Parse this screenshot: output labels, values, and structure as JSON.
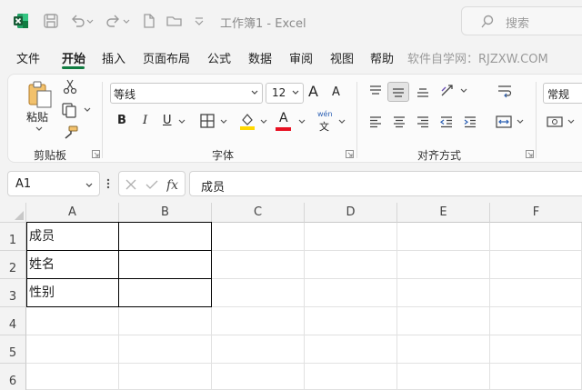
{
  "title": "工作簿1 - Excel",
  "search": {
    "placeholder": "搜索"
  },
  "menu": [
    "文件",
    "开始",
    "插入",
    "页面布局",
    "公式",
    "数据",
    "审阅",
    "视图",
    "帮助"
  ],
  "menu_active": "开始",
  "watermark": "软件自学网：RJZXW.COM",
  "ribbon": {
    "clipboard": {
      "paste_label": "粘贴",
      "group_label": "剪贴板"
    },
    "font": {
      "font_name": "等线",
      "font_size": "12",
      "grow_label": "A",
      "shrink_label": "A",
      "bold": "B",
      "italic": "I",
      "underline": "U",
      "font_color_label": "A",
      "phonetic_top": "wén",
      "phonetic_bottom": "文",
      "group_label": "字体"
    },
    "alignment": {
      "group_label": "对齐方式"
    },
    "number": {
      "format": "常规"
    }
  },
  "formula_bar": {
    "name_box": "A1",
    "content": "成员"
  },
  "columns": [
    "A",
    "B",
    "C",
    "D",
    "E",
    "F"
  ],
  "rows": [
    "1",
    "2",
    "3",
    "4",
    "5",
    "6"
  ],
  "cells": {
    "A1": "成员",
    "A2": "姓名",
    "A3": "性别"
  },
  "colors": {
    "accent": "#107c41",
    "font_color": "#e81123",
    "highlight": "#ffd800"
  }
}
